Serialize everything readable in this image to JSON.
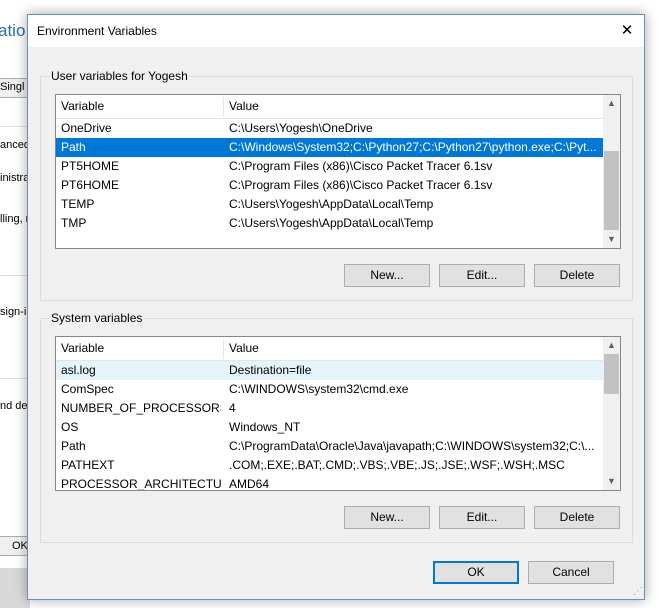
{
  "background_window": {
    "title_fragment": "atio",
    "fragments": [
      "Singl",
      "anced",
      "inistra",
      "lling, n",
      "sign-in",
      "nd deb",
      "OK"
    ]
  },
  "dialog": {
    "title": "Environment Variables",
    "user_group": {
      "label": "User variables for Yogesh",
      "columns": [
        "Variable",
        "Value"
      ],
      "rows": [
        {
          "name": "OneDrive",
          "value": "C:\\Users\\Yogesh\\OneDrive"
        },
        {
          "name": "Path",
          "value": "C:\\Windows\\System32;C:\\Python27;C:\\Python27\\python.exe;C:\\Pyt...",
          "selected": true
        },
        {
          "name": "PT5HOME",
          "value": "C:\\Program Files (x86)\\Cisco Packet Tracer 6.1sv"
        },
        {
          "name": "PT6HOME",
          "value": "C:\\Program Files (x86)\\Cisco Packet Tracer 6.1sv"
        },
        {
          "name": "TEMP",
          "value": "C:\\Users\\Yogesh\\AppData\\Local\\Temp"
        },
        {
          "name": "TMP",
          "value": "C:\\Users\\Yogesh\\AppData\\Local\\Temp"
        }
      ],
      "buttons": {
        "new": "New...",
        "edit": "Edit...",
        "delete": "Delete"
      }
    },
    "system_group": {
      "label": "System variables",
      "columns": [
        "Variable",
        "Value"
      ],
      "rows": [
        {
          "name": "asl.log",
          "value": "Destination=file",
          "highlighted": true
        },
        {
          "name": "ComSpec",
          "value": "C:\\WINDOWS\\system32\\cmd.exe"
        },
        {
          "name": "NUMBER_OF_PROCESSORS",
          "value": "4"
        },
        {
          "name": "OS",
          "value": "Windows_NT"
        },
        {
          "name": "Path",
          "value": "C:\\ProgramData\\Oracle\\Java\\javapath;C:\\WINDOWS\\system32;C:\\..."
        },
        {
          "name": "PATHEXT",
          "value": ".COM;.EXE;.BAT;.CMD;.VBS;.VBE;.JS;.JSE;.WSF;.WSH;.MSC"
        },
        {
          "name": "PROCESSOR_ARCHITECTURE",
          "value": "AMD64"
        }
      ],
      "buttons": {
        "new": "New...",
        "edit": "Edit...",
        "delete": "Delete"
      }
    },
    "ok_label": "OK",
    "cancel_label": "Cancel",
    "icons": {
      "close": "close-icon",
      "scroll_up": "scroll-up-arrow-icon",
      "scroll_down": "scroll-down-arrow-icon",
      "resize": "resize-grip-icon"
    },
    "colors": {
      "selection": "#0078d7",
      "hover_row": "#e5f3fb",
      "dialog_bg": "#f0f0f0",
      "default_button_border": "#0078d7"
    }
  }
}
